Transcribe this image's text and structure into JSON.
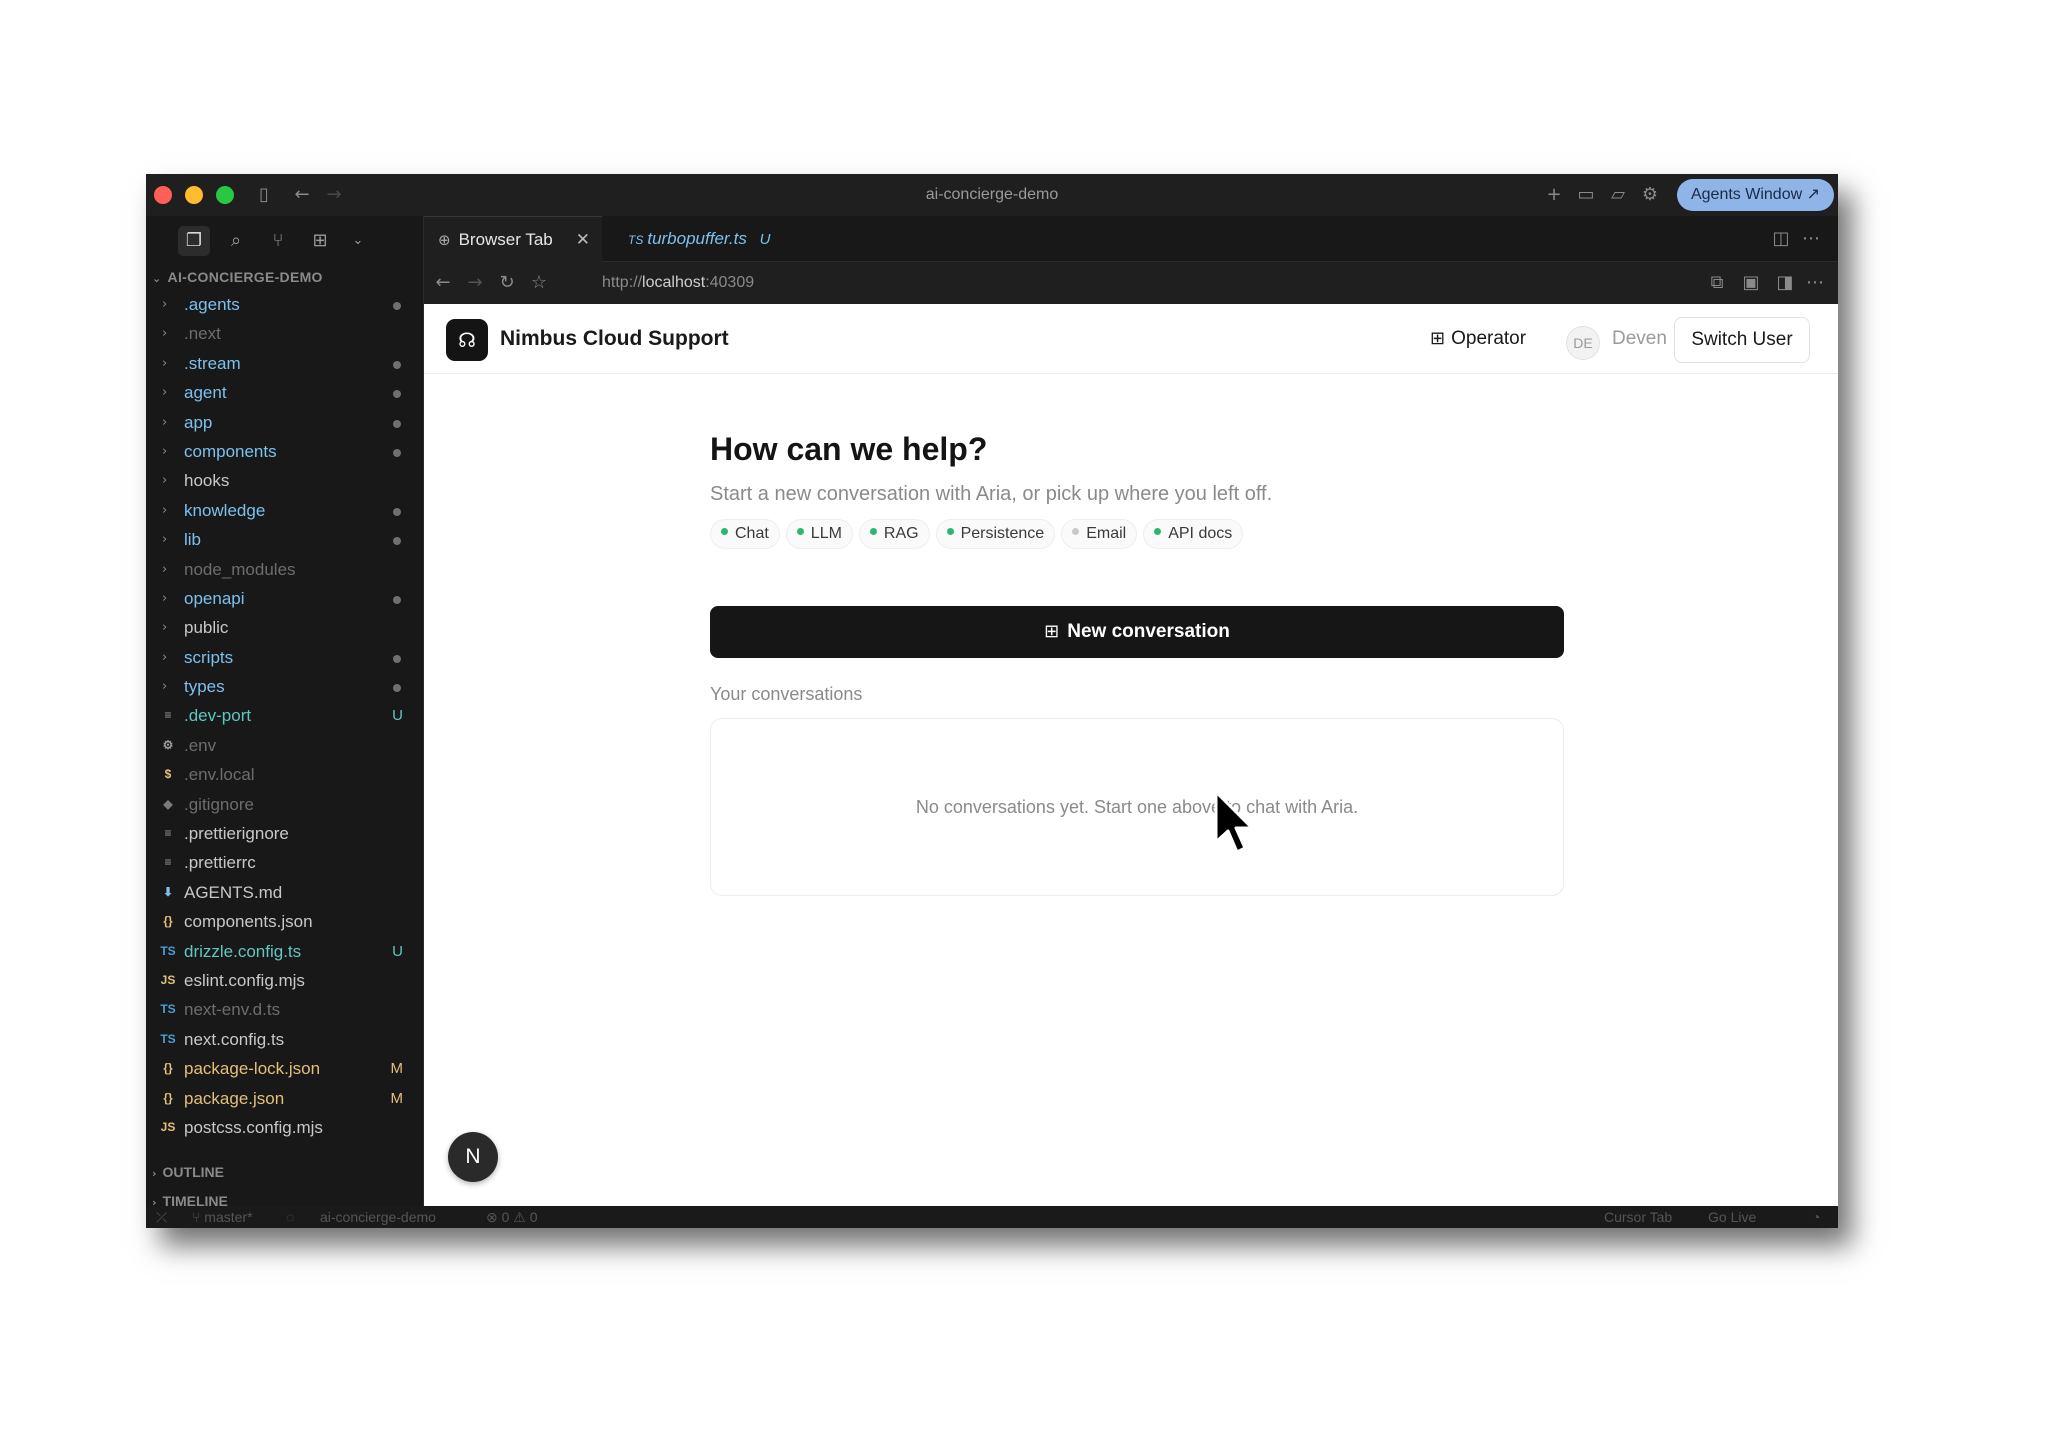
{
  "window": {
    "title": "ai-concierge-demo",
    "agents_button": "Agents Window ↗"
  },
  "sidebar": {
    "header": "AI-CONCIERGE-DEMO",
    "items": [
      {
        "label": ".agents",
        "kind": "folder",
        "color": "blue",
        "marker": "dot"
      },
      {
        "label": ".next",
        "kind": "folder",
        "color": "dim",
        "marker": ""
      },
      {
        "label": ".stream",
        "kind": "folder",
        "color": "blue",
        "marker": "dot"
      },
      {
        "label": "agent",
        "kind": "folder",
        "color": "blue",
        "marker": "dot"
      },
      {
        "label": "app",
        "kind": "folder",
        "color": "blue",
        "marker": "dot"
      },
      {
        "label": "components",
        "kind": "folder",
        "color": "blue",
        "marker": "dot"
      },
      {
        "label": "hooks",
        "kind": "folder",
        "color": "plain",
        "marker": ""
      },
      {
        "label": "knowledge",
        "kind": "folder",
        "color": "blue",
        "marker": "dot"
      },
      {
        "label": "lib",
        "kind": "folder",
        "color": "blue",
        "marker": "dot"
      },
      {
        "label": "node_modules",
        "kind": "folder",
        "color": "dim",
        "marker": ""
      },
      {
        "label": "openapi",
        "kind": "folder",
        "color": "blue",
        "marker": "dot"
      },
      {
        "label": "public",
        "kind": "folder",
        "color": "plain",
        "marker": ""
      },
      {
        "label": "scripts",
        "kind": "folder",
        "color": "blue",
        "marker": "dot"
      },
      {
        "label": "types",
        "kind": "folder",
        "color": "blue",
        "marker": "dot"
      },
      {
        "label": ".dev-port",
        "kind": "file",
        "icon": "≡",
        "icon_color": "#9a9a9a",
        "color": "untracked",
        "marker": "U"
      },
      {
        "label": ".env",
        "kind": "file",
        "icon": "⚙",
        "icon_color": "#9a9a9a",
        "color": "dim",
        "marker": ""
      },
      {
        "label": ".env.local",
        "kind": "file",
        "icon": "$",
        "icon_color": "#e2c07a",
        "color": "dim",
        "marker": ""
      },
      {
        "label": ".gitignore",
        "kind": "file",
        "icon": "◆",
        "icon_color": "#7a7a7a",
        "color": "dim",
        "marker": ""
      },
      {
        "label": ".prettierignore",
        "kind": "file",
        "icon": "≡",
        "icon_color": "#9a9a9a",
        "color": "plain",
        "marker": ""
      },
      {
        "label": ".prettierrc",
        "kind": "file",
        "icon": "≡",
        "icon_color": "#9a9a9a",
        "color": "plain",
        "marker": ""
      },
      {
        "label": "AGENTS.md",
        "kind": "file",
        "icon": "⬇",
        "icon_color": "#7cc0ee",
        "color": "plain",
        "marker": ""
      },
      {
        "label": "components.json",
        "kind": "file",
        "icon": "{}",
        "icon_color": "#e2c07a",
        "color": "plain",
        "marker": ""
      },
      {
        "label": "drizzle.config.ts",
        "kind": "file",
        "icon": "TS",
        "icon_color": "#4a9fd8",
        "color": "untracked",
        "marker": "U"
      },
      {
        "label": "eslint.config.mjs",
        "kind": "file",
        "icon": "JS",
        "icon_color": "#e2c07a",
        "color": "plain",
        "marker": ""
      },
      {
        "label": "next-env.d.ts",
        "kind": "file",
        "icon": "TS",
        "icon_color": "#4a9fd8",
        "color": "dim",
        "marker": ""
      },
      {
        "label": "next.config.ts",
        "kind": "file",
        "icon": "TS",
        "icon_color": "#4a9fd8",
        "color": "plain",
        "marker": ""
      },
      {
        "label": "package-lock.json",
        "kind": "file",
        "icon": "{}",
        "icon_color": "#e2c07a",
        "color": "yellow",
        "marker": "M"
      },
      {
        "label": "package.json",
        "kind": "file",
        "icon": "{}",
        "icon_color": "#e2c07a",
        "color": "yellow",
        "marker": "M"
      },
      {
        "label": "postcss.config.mjs",
        "kind": "file",
        "icon": "JS",
        "icon_color": "#e2c07a",
        "color": "plain",
        "marker": ""
      }
    ],
    "outline_label": "OUTLINE",
    "timeline_label": "TIMELINE"
  },
  "tabs": {
    "active_label": "Browser Tab",
    "second_prefix": "TS",
    "second_label": "turbopuffer.ts",
    "second_status": "U"
  },
  "browser": {
    "url_prefix": "http://",
    "url_host": "localhost",
    "url_suffix": ":40309"
  },
  "app": {
    "title": "Nimbus Cloud Support",
    "operator_label": "Operator",
    "avatar_initials": "DE",
    "user_name": "Deven",
    "switch_user_label": "Switch User",
    "heading": "How can we help?",
    "subtitle": "Start a new conversation with Aria, or pick up where you left off.",
    "features": [
      {
        "label": "Chat",
        "active": true
      },
      {
        "label": "LLM",
        "active": true
      },
      {
        "label": "RAG",
        "active": true
      },
      {
        "label": "Persistence",
        "active": true
      },
      {
        "label": "Email",
        "active": false
      },
      {
        "label": "API docs",
        "active": true
      }
    ],
    "new_conversation_label": "New conversation",
    "conversations_label": "Your conversations",
    "empty_state": "No conversations yet. Start one above to chat with Aria.",
    "fab_label": "N"
  },
  "statusbar": {
    "branch": "master*",
    "project": "ai-concierge-demo",
    "problems": "⊗ 0 ⚠ 0",
    "cursor_tab": "Cursor Tab",
    "go_live": "Go Live"
  },
  "colors": {
    "accent_green": "#2bb673",
    "traffic_red": "#ff5f57",
    "traffic_yellow": "#febc2e",
    "traffic_green": "#28c840",
    "agents_button_bg": "#8fb4e8"
  }
}
